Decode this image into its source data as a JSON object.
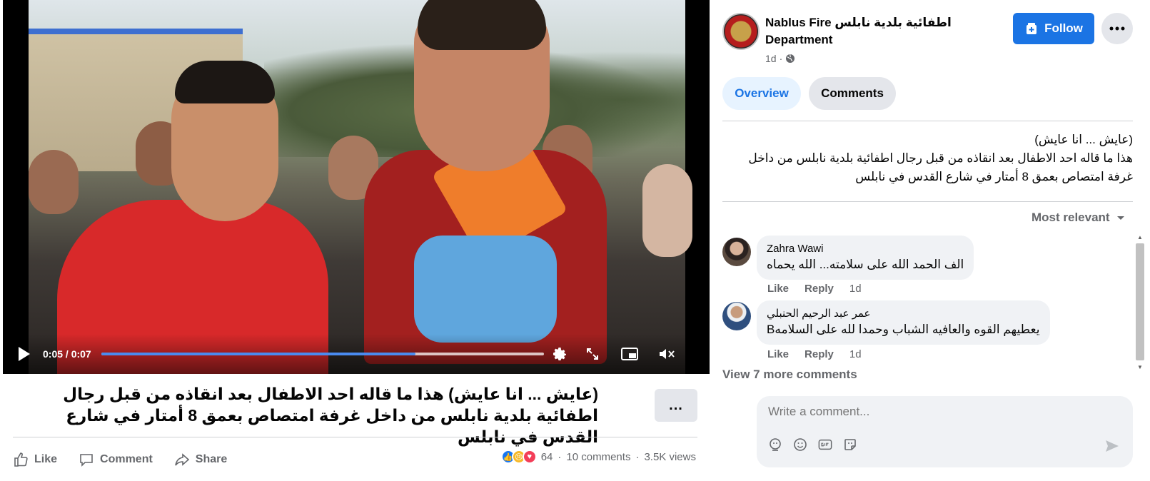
{
  "video": {
    "time": "0:05 / 0:07",
    "progress_fraction": 0.71
  },
  "caption": "(عايش ... انا عايش) هذا ما قاله احد الاطفال بعد انقاذه من قبل رجال اطفائية بلدية نابلس من داخل غرفة امتصاص بعمق 8 أمتار في شارع القدس في نابلس",
  "more_menu": "...",
  "actions": {
    "like": "Like",
    "comment": "Comment",
    "share": "Share"
  },
  "stats": {
    "reactions": "64",
    "comments": "10 comments",
    "views": "3.5K views",
    "separator": "·"
  },
  "page": {
    "name": "Nablus Fire اطفائية بلدية نابلس Department",
    "time": "1d",
    "dot": "·"
  },
  "follow_label": "Follow",
  "tabs": {
    "overview": "Overview",
    "comments": "Comments"
  },
  "post": {
    "line1": "(عايش ... انا عايش)",
    "line2": "هذا ما قاله احد الاطفال بعد انقاذه من قبل رجال اطفائية بلدية نابلس من داخل غرفة امتصاص بعمق 8 أمتار في شارع القدس في نابلس"
  },
  "sort_label": "Most relevant",
  "comments": [
    {
      "author": "Zahra Wawi",
      "text": "الف الحمد الله على سلامته... الله يحماه",
      "like": "Like",
      "reply": "Reply",
      "time": "1d"
    },
    {
      "author": "عمر عبد الرحيم الحنبلي",
      "text": "يعطيهم القوه والعافيه الشباب وحمدا لله على السلامهB",
      "like": "Like",
      "reply": "Reply",
      "time": "1d"
    }
  ],
  "view_more": "View 7 more comments",
  "composer": {
    "placeholder": "Write a comment..."
  },
  "colors": {
    "accent": "#1b74e4",
    "progress": "#4a8bf0"
  }
}
